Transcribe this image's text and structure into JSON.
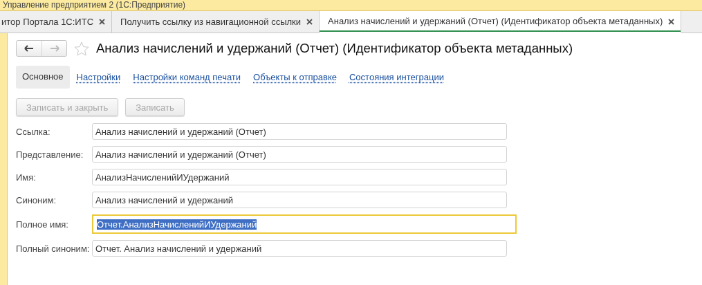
{
  "window": {
    "title": "Управление предприятием 2 (1С:Предприятие)"
  },
  "tabs": [
    {
      "label": "итор Портала 1С:ИТС",
      "selected": false
    },
    {
      "label": "Получить ссылку из навигационной ссылки",
      "selected": false
    },
    {
      "label": "Анализ начислений и удержаний (Отчет) (Идентификатор объекта метаданных)",
      "selected": true
    }
  ],
  "nav": {
    "back_disabled": false,
    "forward_disabled": true
  },
  "favorite": false,
  "form_title": "Анализ начислений и удержаний (Отчет) (Идентификатор объекта метаданных)",
  "form_tabs": [
    {
      "label": "Основное",
      "selected": true
    },
    {
      "label": "Настройки",
      "selected": false
    },
    {
      "label": "Настройки команд печати",
      "selected": false
    },
    {
      "label": "Объекты к отправке",
      "selected": false
    },
    {
      "label": "Состояния интеграции",
      "selected": false
    }
  ],
  "buttons": [
    {
      "label": "Записать и закрыть",
      "disabled": true
    },
    {
      "label": "Записать",
      "disabled": true
    }
  ],
  "field_groups": [
    [
      {
        "label": "Ссылка:",
        "value": "Анализ начислений и удержаний (Отчет)",
        "focused": false
      },
      {
        "label": "Представление:",
        "value": "Анализ начислений и удержаний (Отчет)",
        "focused": false
      }
    ],
    [
      {
        "label": "Имя:",
        "value": "АнализНачисленийИУдержаний",
        "focused": false
      },
      {
        "label": "Синоним:",
        "value": "Анализ начислений и удержаний",
        "focused": false
      }
    ],
    [
      {
        "label": "Полное имя:",
        "value": "Отчет.АнализНачисленийИУдержаний",
        "focused": true
      },
      {
        "label": "Полный синоним:",
        "value": "Отчет. Анализ начислений и удержаний",
        "focused": false
      }
    ]
  ]
}
